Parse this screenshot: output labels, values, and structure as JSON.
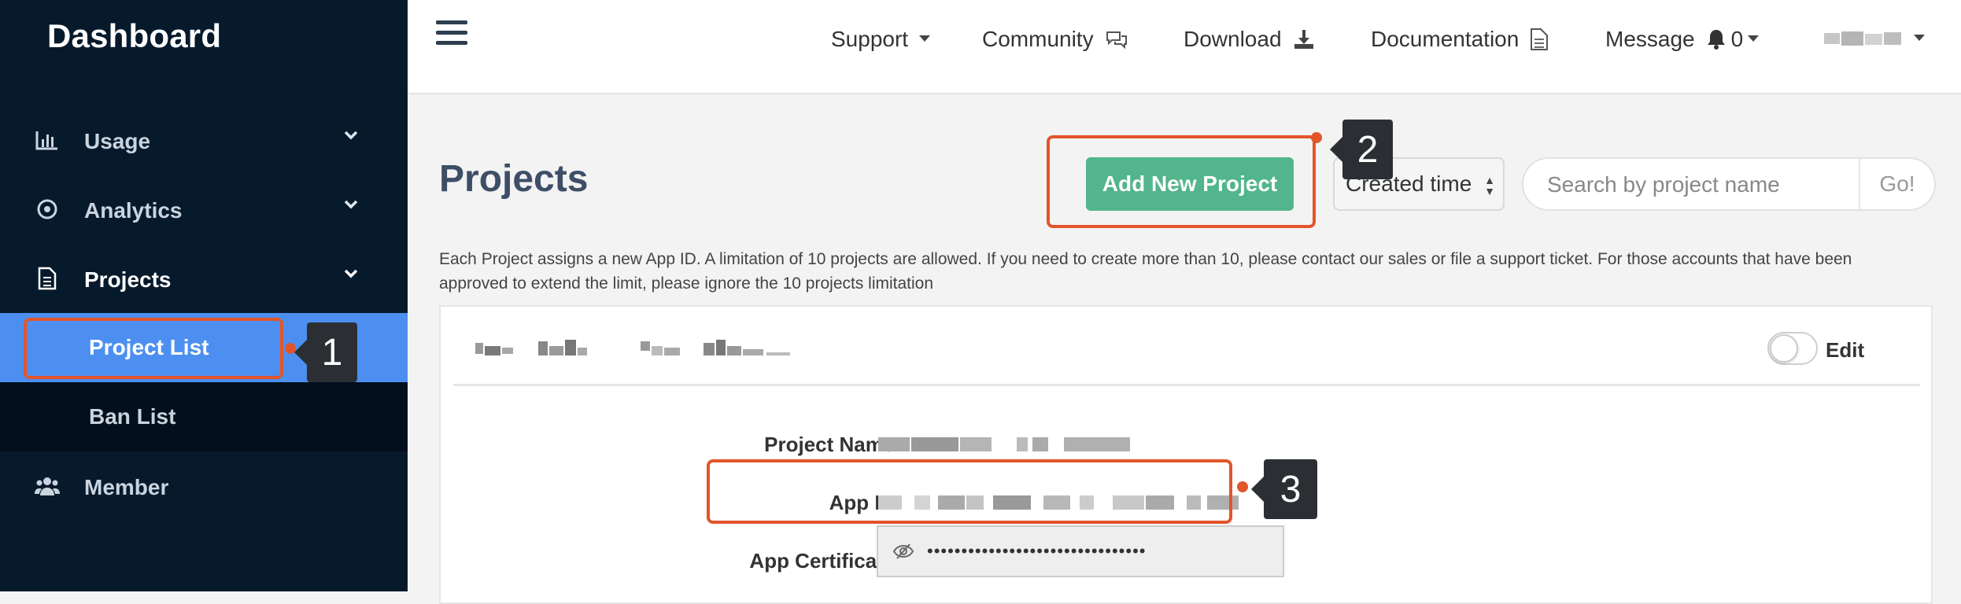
{
  "sidebar": {
    "brand": "Dashboard",
    "items": [
      {
        "label": "Usage",
        "icon": "bar-chart-icon"
      },
      {
        "label": "Analytics",
        "icon": "target-icon"
      },
      {
        "label": "Projects",
        "icon": "document-icon"
      },
      {
        "label": "Member",
        "icon": "users-icon"
      }
    ],
    "sub_items": [
      {
        "label": "Project List"
      },
      {
        "label": "Ban List"
      }
    ]
  },
  "topbar": {
    "support": "Support",
    "community": "Community",
    "download": "Download",
    "documentation": "Documentation",
    "message": "Message",
    "message_count": "0"
  },
  "main": {
    "title": "Projects",
    "add_button": "Add New Project",
    "sort_selected": "Created time",
    "search_placeholder": "Search by project name",
    "search_go": "Go!",
    "description": "Each Project assigns a new App ID. A limitation of 10 projects are allowed. If you need to create more than 10, please contact our sales or file a support ticket. For those accounts that have been approved to extend the limit, please ignore the 10 projects limitation",
    "panel": {
      "edit_label": "Edit",
      "fields": {
        "project_name_label": "Project Name:",
        "app_id_label": "App ID:",
        "app_certificate_label": "App Certificate:",
        "app_certificate_value": "••••••••••••••••••••••••••••••••"
      }
    }
  },
  "callouts": [
    "1",
    "2",
    "3"
  ],
  "colors": {
    "sidebar_bg": "#071a2c",
    "selected_bg": "#4c8ff0",
    "primary_green": "#52b58b",
    "highlight": "#e2552a",
    "callout_bg": "#2b2f34"
  }
}
